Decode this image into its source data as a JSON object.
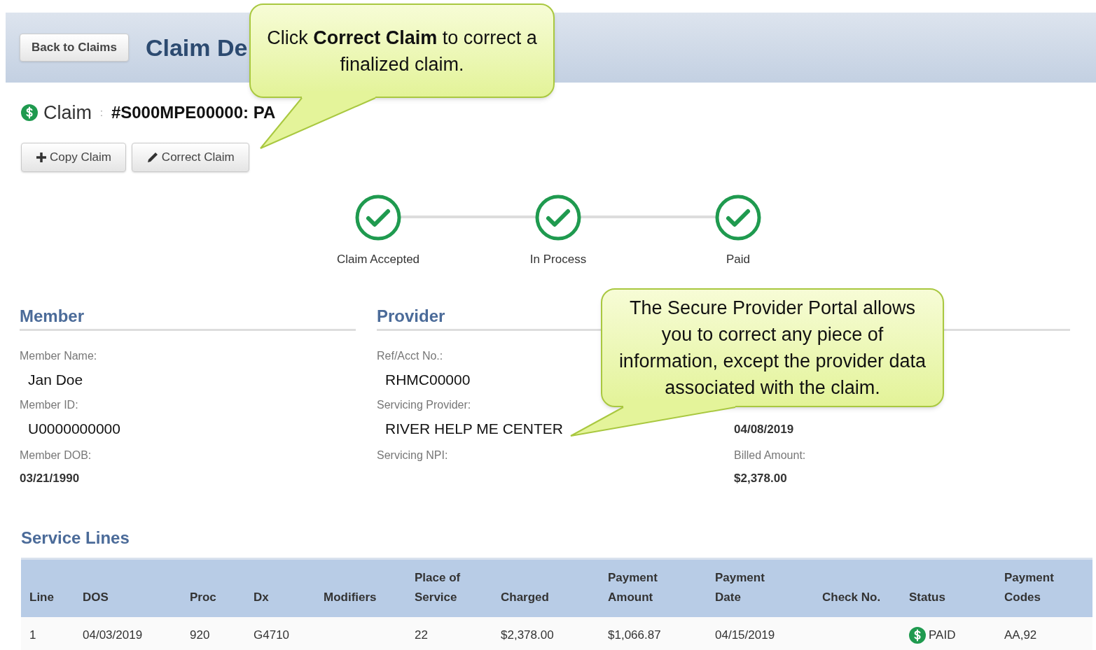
{
  "header": {
    "back_button": "Back to Claims",
    "title": "Claim De"
  },
  "claim": {
    "label": "Claim",
    "separator": ":",
    "number": "#S000MPE00000: PA"
  },
  "actions": [
    {
      "label": "Copy Claim",
      "kind": "copy"
    },
    {
      "label": "Correct Claim",
      "kind": "edit"
    }
  ],
  "progress": [
    {
      "label": "Claim Accepted",
      "done": true
    },
    {
      "label": "In Process",
      "done": true
    },
    {
      "label": "Paid",
      "done": true
    }
  ],
  "sections": [
    {
      "heading": "Member",
      "fields": [
        {
          "label": "Member Name:",
          "value": "Jan Doe",
          "kind": "large"
        },
        {
          "label": "Member ID:",
          "value": "U0000000000",
          "kind": "large"
        },
        {
          "label": "Member DOB:",
          "value": "03/21/1990",
          "kind": "small"
        }
      ]
    },
    {
      "heading": "Provider",
      "fields": [
        {
          "label": "Ref/Acct No.:",
          "value": "RHMC00000",
          "kind": "large"
        },
        {
          "label": "Servicing Provider:",
          "value": "RIVER HELP ME CENTER",
          "kind": "large"
        },
        {
          "label": "Servicing NPI:",
          "kind": "small"
        }
      ]
    },
    {
      "fields": [
        {
          "value": "04/08/2019",
          "kind": "small"
        },
        {
          "label": "Billed Amount:",
          "value": "$2,378.00",
          "kind": "small"
        }
      ]
    }
  ],
  "service_lines": {
    "heading": "Service Lines",
    "columns": [
      "Line",
      "DOS",
      "Proc",
      "Dx",
      "Modifiers",
      "Place of Service",
      "Charged",
      "Payment Amount",
      "Payment Date",
      "Check No.",
      "Status",
      "Payment Codes"
    ],
    "rows": [
      {
        "cells": [
          {
            "text": "1",
            "kind": "text"
          },
          {
            "text": "04/03/2019",
            "kind": "text"
          },
          {
            "text": "920",
            "kind": "text"
          },
          {
            "text": "G4710",
            "kind": "text"
          },
          null,
          {
            "text": "22",
            "kind": "text"
          },
          {
            "text": "$2,378.00",
            "kind": "text"
          },
          {
            "text": "$1,066.87",
            "kind": "text"
          },
          {
            "text": "04/15/2019",
            "kind": "text"
          },
          null,
          {
            "text": "PAID",
            "kind": "paid"
          },
          {
            "text": "AA,92",
            "kind": "text"
          }
        ]
      }
    ]
  },
  "callouts": [
    {
      "text": "Click **Correct Claim** to correct a finalized claim."
    },
    {
      "text": "The Secure Provider Portal allows you to correct any piece of information, except the provider data associated with the claim."
    }
  ]
}
